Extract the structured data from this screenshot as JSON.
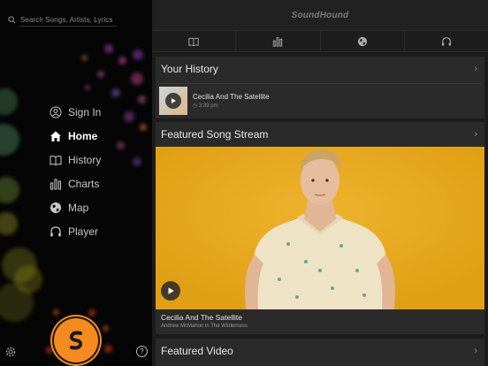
{
  "sidebar": {
    "search_placeholder": "Search Songs, Artists, Lyrics",
    "menu": [
      {
        "label": "Sign In",
        "icon": "user-circle-icon"
      },
      {
        "label": "Home",
        "icon": "home-icon",
        "active": true
      },
      {
        "label": "History",
        "icon": "book-icon"
      },
      {
        "label": "Charts",
        "icon": "bar-chart-icon"
      },
      {
        "label": "Map",
        "icon": "globe-icon"
      },
      {
        "label": "Player",
        "icon": "headphones-icon"
      }
    ],
    "help_label": "?"
  },
  "header": {
    "title": "SoundHound",
    "tabs": [
      {
        "icon": "book-icon"
      },
      {
        "icon": "bar-chart-icon"
      },
      {
        "icon": "globe-icon"
      },
      {
        "icon": "headphones-icon"
      }
    ]
  },
  "history": {
    "title": "Your History",
    "items": [
      {
        "title": "Cecilia And The Satellite",
        "time": "3:39 pm"
      }
    ]
  },
  "featured": {
    "title": "Featured Song Stream",
    "song": "Cecilia And The Satellite",
    "artist": "Andrew McMahon in The Wilderness"
  },
  "video": {
    "title": "Featured Video"
  },
  "colors": {
    "brand_orange": "#f58a1f",
    "featured_bg": "#e8a81a"
  }
}
